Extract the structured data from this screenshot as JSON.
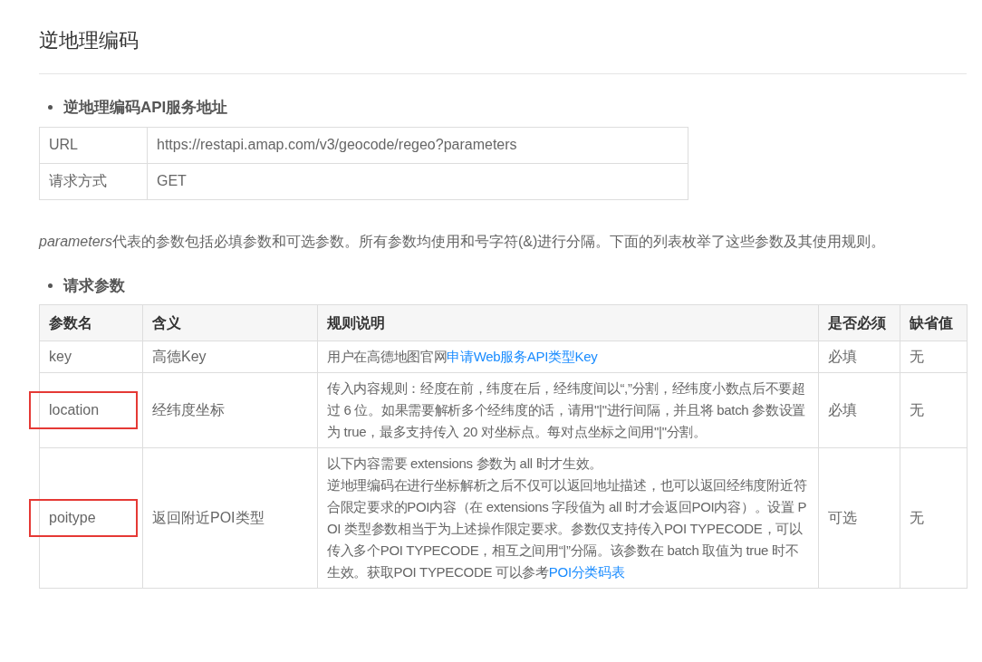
{
  "title": "逆地理编码",
  "service_section": {
    "heading": "逆地理编码API服务地址",
    "rows": [
      {
        "label": "URL",
        "value": "https://restapi.amap.com/v3/geocode/regeo?parameters"
      },
      {
        "label": "请求方式",
        "value": "GET"
      }
    ]
  },
  "intro": {
    "emphasis": "parameters",
    "text": "代表的参数包括必填参数和可选参数。所有参数均使用和号字符(&)进行分隔。下面的列表枚举了这些参数及其使用规则。"
  },
  "params_section": {
    "heading": "请求参数",
    "columns": [
      "参数名",
      "含义",
      "规则说明",
      "是否必须",
      "缺省值"
    ],
    "rows": [
      {
        "name": "key",
        "highlighted": false,
        "meaning": "高德Key",
        "rule": {
          "paragraphs": [
            "用户在高德地图官网"
          ],
          "link": "申请Web服务API类型Key"
        },
        "required": "必填",
        "default": "无"
      },
      {
        "name": "location",
        "highlighted": true,
        "meaning": "经纬度坐标",
        "rule": {
          "paragraphs": [
            "传入内容规则：经度在前，纬度在后，经纬度间以“,”分割，经纬度小数点后不要超过 6 位。如果需要解析多个经纬度的话，请用\"|\"进行间隔，并且将 batch 参数设置为 true，最多支持传入 20 对坐标点。每对点坐标之间用\"|\"分割。"
          ]
        },
        "required": "必填",
        "default": "无"
      },
      {
        "name": "poitype",
        "highlighted": true,
        "meaning": "返回附近POI类型",
        "rule": {
          "paragraphs": [
            "以下内容需要 extensions 参数为 all 时才生效。",
            "逆地理编码在进行坐标解析之后不仅可以返回地址描述，也可以返回经纬度附近符合限定要求的POI内容（在 extensions 字段值为 all 时才会返回POI内容）。设置 POI 类型参数相当于为上述操作限定要求。参数仅支持传入POI TYPECODE，可以传入多个POI TYPECODE，相互之间用“|”分隔。该参数在 batch 取值为 true 时不生效。获取POI TYPECODE 可以参考"
          ],
          "link": "POI分类码表"
        },
        "required": "可选",
        "default": "无"
      }
    ]
  }
}
